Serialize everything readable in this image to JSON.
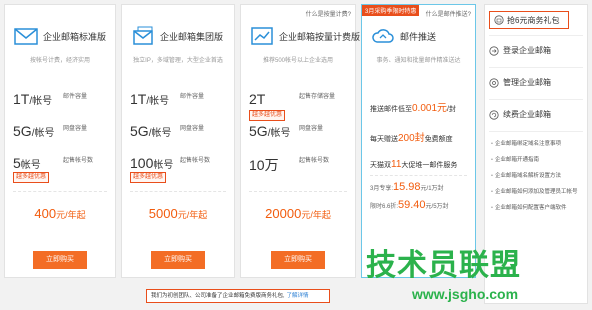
{
  "cards": [
    {
      "title": "企业邮箱标准版",
      "desc": "按帐号计费，经济实用",
      "rows": [
        {
          "value": "1T",
          "unit": "/帐号",
          "label": "邮件容量"
        },
        {
          "value": "5G",
          "unit": "/帐号",
          "label": "网盘容量"
        },
        {
          "value": "5",
          "unit": "帐号",
          "label": "起售帐号数"
        }
      ],
      "badge": "越多越优惠",
      "price": "400",
      "price_unit": "元/年起",
      "buy_label": "立即购买"
    },
    {
      "title": "企业邮箱集团版",
      "desc": "独立IP，多域管理，大型企业首选",
      "rows": [
        {
          "value": "1T",
          "unit": "/帐号",
          "label": "邮件容量"
        },
        {
          "value": "5G",
          "unit": "/帐号",
          "label": "网盘容量"
        },
        {
          "value": "100",
          "unit": "帐号",
          "label": "起售帐号数"
        }
      ],
      "badge": "越多越优惠",
      "price": "5000",
      "price_unit": "元/年起",
      "buy_label": "立即购买"
    },
    {
      "top_link": "什么是按量计费?",
      "title": "企业邮箱按量计费版",
      "desc": "推荐500帐号以上企业选用",
      "rows": [
        {
          "value": "2T",
          "unit": "",
          "label": "起售存储容量"
        },
        {
          "value": "5G",
          "unit": "/帐号",
          "label": "网盘容量"
        },
        {
          "value": "10万",
          "unit": "",
          "label": "起售帐号数"
        }
      ],
      "badge": "越多越优惠",
      "price": "20000",
      "price_unit": "元/年起",
      "buy_label": "立即购买"
    },
    {
      "promo_tag": "3月采购季限时特惠",
      "top_link": "什么是邮件推送?",
      "title": "邮件推送",
      "desc": "事务、通知和批量邮件精准送达",
      "p1_prefix": "推送邮件低至",
      "p1_price": "0.001元",
      "p1_suffix": "/封",
      "p2_prefix": "每天赠送",
      "p2_count": "200封",
      "p2_suffix": "免费额度",
      "p3_prefix": "天猫双",
      "p3_count": "11",
      "p3_suffix": "大促堆一邮件服务",
      "s1_prefix": "3月专享:",
      "s1_price": "15.98",
      "s1_suffix": "元/1万封",
      "s2_prefix": "限时6.6折:",
      "s2_price": "59.40",
      "s2_suffix": "元/5万封"
    }
  ],
  "sidebar": {
    "gift": "抢6元商务礼包",
    "items": [
      "登录企业邮箱",
      "管理企业邮箱",
      "续费企业邮箱"
    ],
    "links": [
      "企业邮箱绑定域名注意事项",
      "企业邮箱开通指南",
      "企业邮箱域名解析设置方法",
      "企业邮箱如何添加及管理员工帐号",
      "企业邮箱如何配置客户端软件"
    ]
  },
  "notice": {
    "text": "我们为初创团队、公司准备了企业邮箱免费版商务礼包,",
    "link": "了解详情"
  },
  "watermark": {
    "line1": "技术员联盟",
    "line2": "www.jsgho.com"
  },
  "colors": {
    "accent": "#f36d25",
    "price": "#f25c0e",
    "promo": "#e94e1b",
    "watermark": "#2bb24c"
  }
}
